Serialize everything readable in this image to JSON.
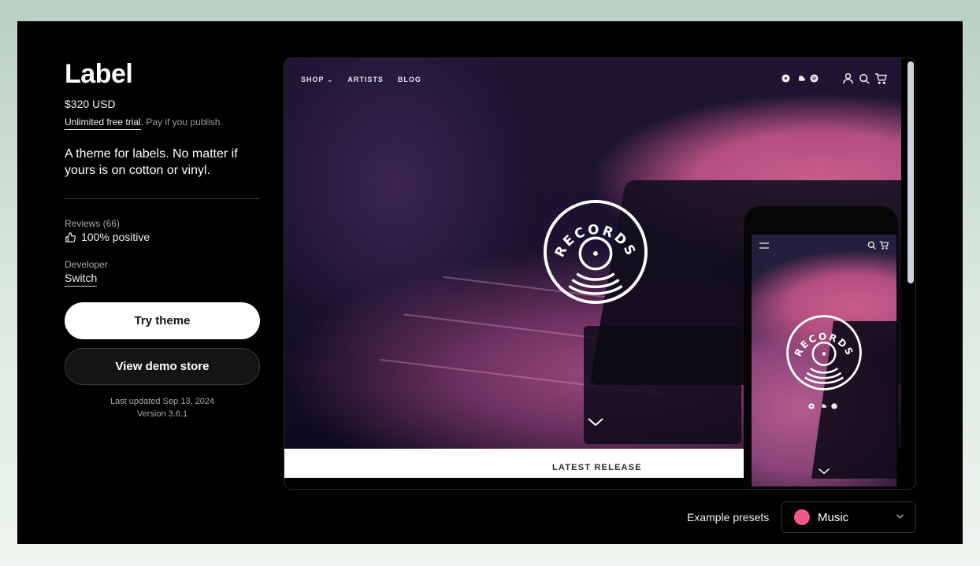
{
  "product": {
    "title": "Label",
    "price": "$320 USD",
    "trial_link": "Unlimited free trial",
    "trial_suffix": ". Pay if you publish.",
    "description": "A theme for labels. No matter if yours is on cotton or vinyl.",
    "reviews_label": "Reviews (66)",
    "reviews_value": "100% positive",
    "developer_label": "Developer",
    "developer_name": "Switch",
    "try_button": "Try theme",
    "demo_button": "View demo store",
    "last_updated": "Last updated Sep 13, 2024",
    "version": "Version 3.6.1"
  },
  "preview": {
    "nav": [
      "SHOP",
      "ARTISTS",
      "BLOG"
    ],
    "shop_has_dropdown": true,
    "social_icons": [
      "discogs-icon",
      "soundcloud-icon",
      "spotify-icon"
    ],
    "utility_icons": [
      "account-icon",
      "search-icon",
      "cart-icon"
    ],
    "logo_text": "RECORDS",
    "section_title": "LATEST RELEASE",
    "mobile_logo_text": "RECORDS"
  },
  "presets": {
    "label": "Example presets",
    "selected": "Music",
    "swatch_color": "#f0578a"
  }
}
